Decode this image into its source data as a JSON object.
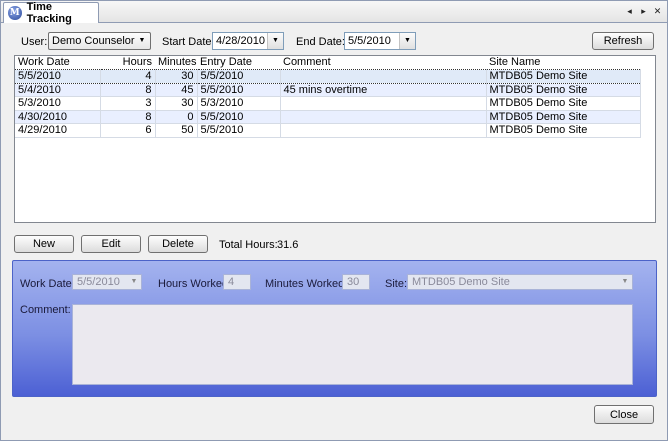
{
  "window": {
    "tab_title": "Time Tracking",
    "logo_glyph": "M",
    "controls": {
      "prev": "◂",
      "next": "▸",
      "close": "✕"
    }
  },
  "filters": {
    "user_label": "User:",
    "user_value": "Demo Counselor",
    "start_label": "Start Date:",
    "start_value": "4/28/2010",
    "end_label": "End Date:",
    "end_value": "5/5/2010",
    "refresh_label": "Refresh"
  },
  "grid": {
    "columns": [
      "Work Date",
      "Hours",
      "Minutes",
      "Entry Date",
      "Comment",
      "Site Name"
    ],
    "rows": [
      {
        "work_date": "5/5/2010",
        "hours": "4",
        "minutes": "30",
        "entry_date": "5/5/2010",
        "comment": "",
        "site": "MTDB05 Demo Site"
      },
      {
        "work_date": "5/4/2010",
        "hours": "8",
        "minutes": "45",
        "entry_date": "5/5/2010",
        "comment": "45 mins overtime",
        "site": "MTDB05 Demo Site"
      },
      {
        "work_date": "5/3/2010",
        "hours": "3",
        "minutes": "30",
        "entry_date": "5/3/2010",
        "comment": "",
        "site": "MTDB05 Demo Site"
      },
      {
        "work_date": "4/30/2010",
        "hours": "8",
        "minutes": "0",
        "entry_date": "5/5/2010",
        "comment": "",
        "site": "MTDB05 Demo Site"
      },
      {
        "work_date": "4/29/2010",
        "hours": "6",
        "minutes": "50",
        "entry_date": "5/5/2010",
        "comment": "",
        "site": "MTDB05 Demo Site"
      }
    ]
  },
  "actions": {
    "new_label": "New",
    "edit_label": "Edit",
    "delete_label": "Delete",
    "total_hours_label": "Total Hours:",
    "total_hours_value": "31.6"
  },
  "detail": {
    "work_date_label": "Work Date:",
    "work_date_value": "5/5/2010",
    "hours_label": "Hours Worked:",
    "hours_value": "4",
    "minutes_label": "Minutes Worked:",
    "minutes_value": "30",
    "site_label": "Site:",
    "site_value": "MTDB05 Demo Site",
    "comment_label": "Comment:"
  },
  "footer": {
    "close_label": "Close"
  },
  "colors": {
    "panel_top": "#a4b3ef",
    "panel_bottom": "#4c60d4",
    "alt_row": "#e9efff"
  },
  "icons": {
    "dropdown": "chevron-down-icon",
    "logo": "app-logo-icon"
  }
}
